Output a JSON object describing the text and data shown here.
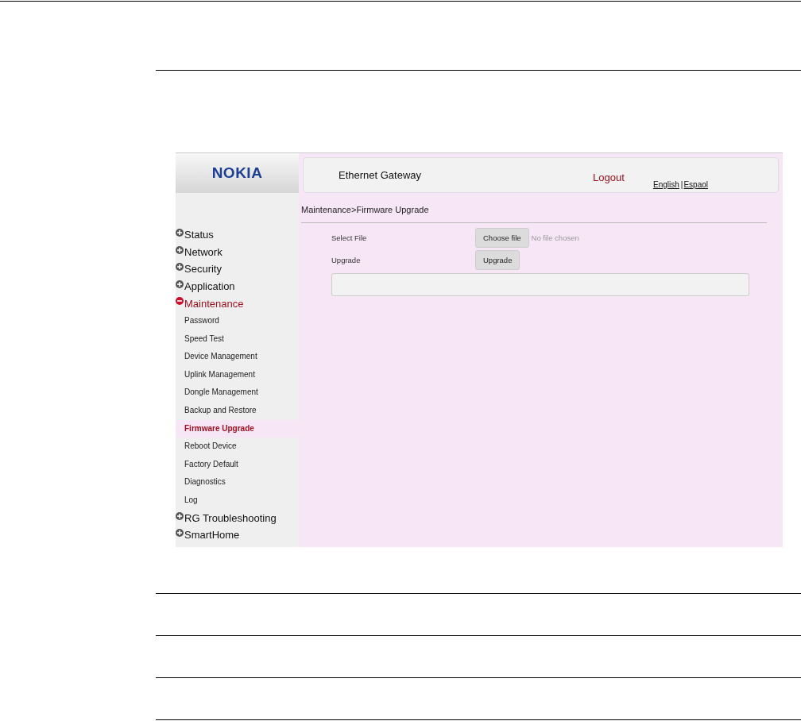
{
  "header": {
    "logo": "NOKIA",
    "title": "Ethernet Gateway",
    "logout": "Logout",
    "languages": [
      "English",
      "Espaol"
    ],
    "language_separator": "|"
  },
  "menu": [
    {
      "label": "Status",
      "expanded": false
    },
    {
      "label": "Network",
      "expanded": false
    },
    {
      "label": "Security",
      "expanded": false
    },
    {
      "label": "Application",
      "expanded": false
    },
    {
      "label": "Maintenance",
      "expanded": true,
      "children": [
        {
          "label": "Password",
          "selected": false
        },
        {
          "label": "Speed Test",
          "selected": false
        },
        {
          "label": "Device Management",
          "selected": false
        },
        {
          "label": "Uplink Management",
          "selected": false
        },
        {
          "label": "Dongle Management",
          "selected": false
        },
        {
          "label": "Backup and Restore",
          "selected": false
        },
        {
          "label": "Firmware Upgrade",
          "selected": true
        },
        {
          "label": "Reboot Device",
          "selected": false
        },
        {
          "label": "Factory Default",
          "selected": false
        },
        {
          "label": "Diagnostics",
          "selected": false
        },
        {
          "label": "Log",
          "selected": false
        }
      ]
    },
    {
      "label": "RG Troubleshooting",
      "expanded": false
    },
    {
      "label": "SmartHome",
      "expanded": false
    }
  ],
  "breadcrumb": "Maintenance>Firmware Upgrade",
  "form": {
    "select_file_label": "Select File",
    "choose_button": "Choose file",
    "file_status": "No file chosen",
    "upgrade_label": "Upgrade",
    "upgrade_button": "Upgrade"
  }
}
